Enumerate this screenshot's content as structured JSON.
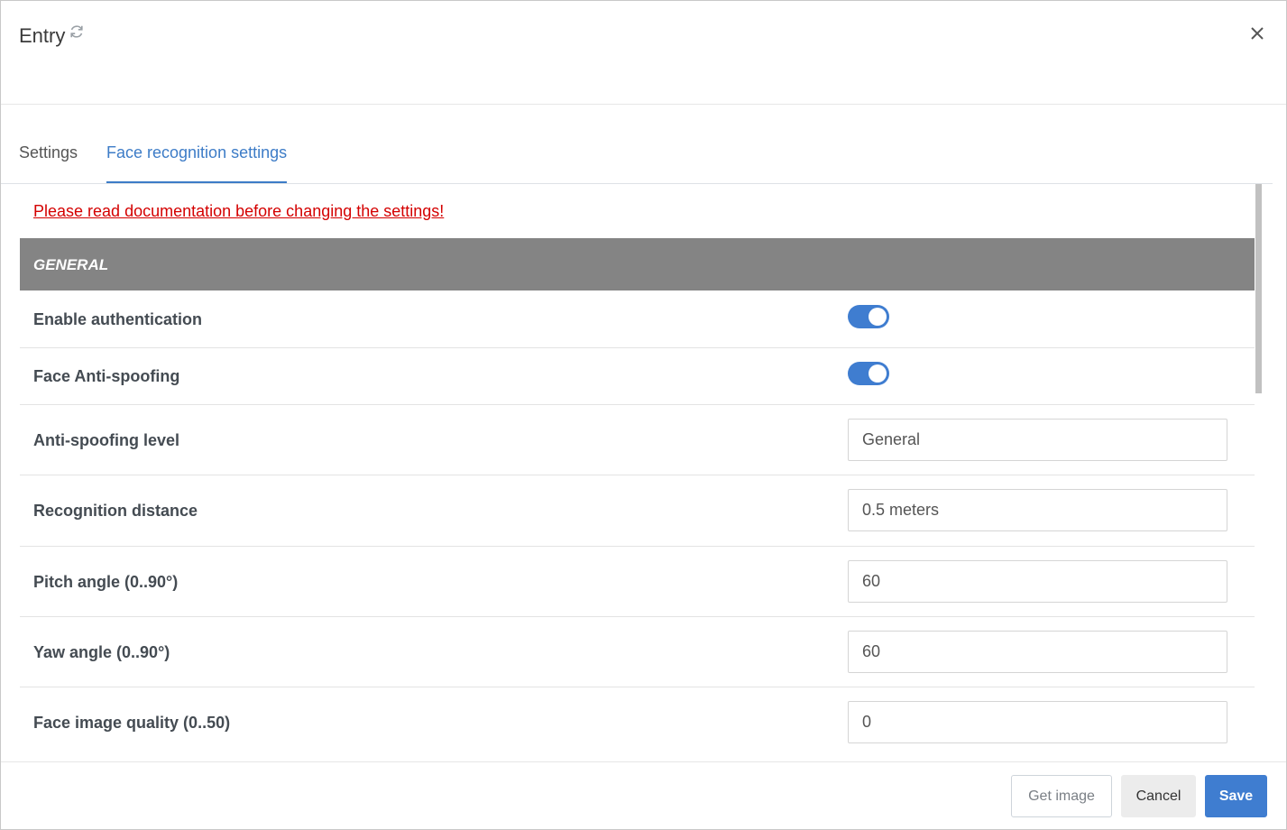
{
  "header": {
    "title": "Entry",
    "refresh_icon": "refresh-icon",
    "close_icon": "close-icon"
  },
  "tabs": [
    {
      "label": "Settings",
      "active": false
    },
    {
      "label": "Face recognition settings",
      "active": true
    }
  ],
  "warning_link": "Please read documentation before changing the settings!",
  "section": {
    "title": "GENERAL"
  },
  "settings": {
    "enable_authentication": {
      "label": "Enable authentication",
      "value": true
    },
    "face_anti_spoofing": {
      "label": "Face Anti-spoofing",
      "value": true
    },
    "anti_spoofing_level": {
      "label": "Anti-spoofing level",
      "value": "General"
    },
    "recognition_distance": {
      "label": "Recognition distance",
      "value": "0.5 meters"
    },
    "pitch_angle": {
      "label": "Pitch angle (0..90°)",
      "value": "60"
    },
    "yaw_angle": {
      "label": "Yaw angle (0..90°)",
      "value": "60"
    },
    "face_image_quality": {
      "label": "Face image quality (0..50)",
      "value": "0"
    }
  },
  "footer": {
    "get_image": "Get image",
    "cancel": "Cancel",
    "save": "Save"
  },
  "colors": {
    "accent": "#3f7dd0",
    "warning": "#d40000",
    "section_bg": "#848484"
  }
}
